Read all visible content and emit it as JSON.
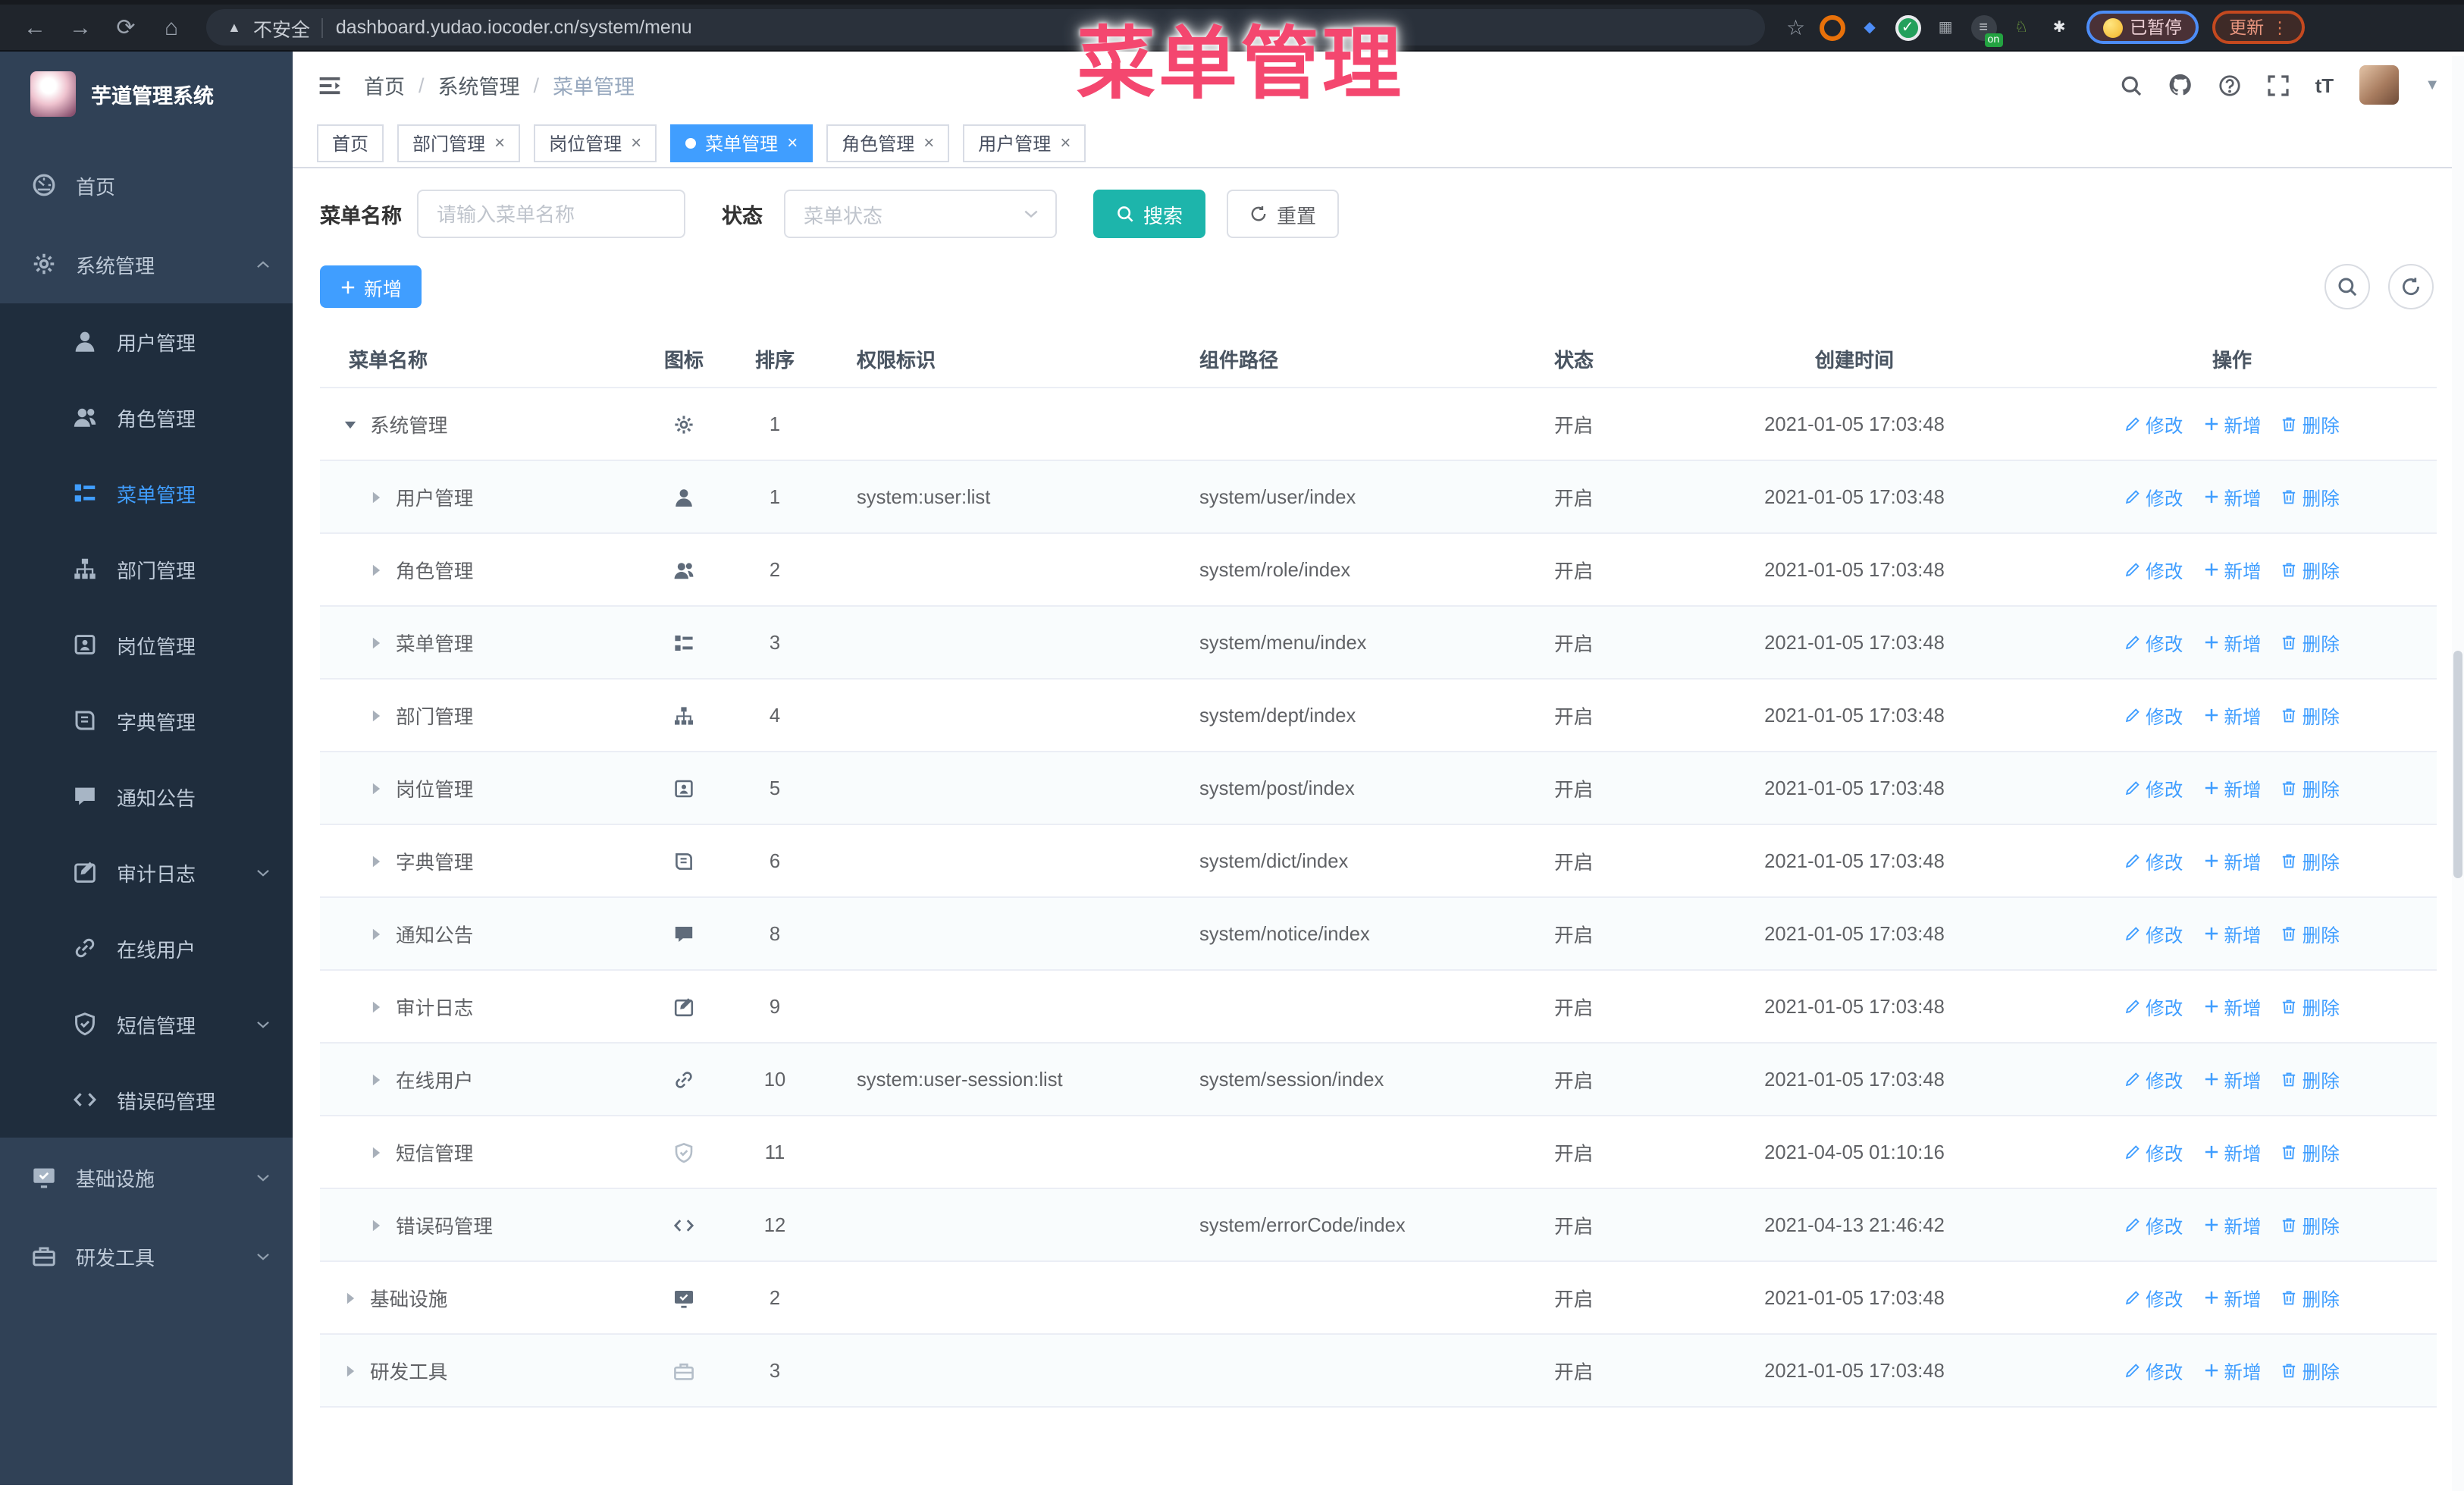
{
  "colors": {
    "accent_blue": "#409eff",
    "search_teal": "#1db5ab",
    "sidebar_bg": "#304156",
    "submenu_bg": "#1f2d3d",
    "overlay_pink": "#f4476f",
    "tab_active_bg": "#409eff"
  },
  "overlay_title": "菜单管理",
  "browser": {
    "back_glyph": "←",
    "forward_glyph": "→",
    "reload_glyph": "⟳",
    "home_glyph": "⌂",
    "warning_glyph": "▲",
    "security_label": "不安全",
    "url": "dashboard.yudao.iocoder.cn/system/menu",
    "star_glyph": "☆",
    "extensions": [
      {
        "name": "extension-icon-orange-ring",
        "glyph": "",
        "color": "#fff",
        "bg": "transparent",
        "border": "3px solid #e8710a"
      },
      {
        "name": "extension-icon-blue-gem",
        "glyph": "◆",
        "color": "#4d8df7",
        "bg": "transparent",
        "border": "none"
      },
      {
        "name": "extension-icon-green-check",
        "glyph": "✓",
        "color": "#fff",
        "bg": "#23a05c",
        "border": "2px solid #e8eaed"
      },
      {
        "name": "extension-icon-gray-tiles",
        "glyph": "▦",
        "color": "#9aa0a6",
        "bg": "transparent",
        "border": "none"
      },
      {
        "name": "extension-icon-dark-on",
        "glyph": "≡",
        "color": "#cdd1d6",
        "bg": "#3a4048",
        "border": "none",
        "badge": "on"
      },
      {
        "name": "extension-icon-green-animal",
        "glyph": "♘",
        "color": "#7cb342",
        "bg": "transparent",
        "border": "none"
      },
      {
        "name": "extension-icon-white-puzzle",
        "glyph": "✱",
        "color": "#e8eaed",
        "bg": "transparent",
        "border": "none"
      }
    ],
    "paused_label": "已暂停",
    "update_label": "更新",
    "update_menu_glyph": "⋮"
  },
  "sidebar": {
    "app_title": "芋道管理系统",
    "items": [
      {
        "label": "首页",
        "icon": "dashboard-icon",
        "level": 0,
        "active": false,
        "chevron": null
      },
      {
        "label": "系统管理",
        "icon": "gear-icon",
        "level": 0,
        "active": false,
        "chevron": "up"
      },
      {
        "label": "用户管理",
        "icon": "user-icon",
        "level": 1,
        "active": false,
        "chevron": null
      },
      {
        "label": "角色管理",
        "icon": "users-icon",
        "level": 1,
        "active": false,
        "chevron": null
      },
      {
        "label": "菜单管理",
        "icon": "menu-list-icon",
        "level": 1,
        "active": true,
        "chevron": null
      },
      {
        "label": "部门管理",
        "icon": "org-tree-icon",
        "level": 1,
        "active": false,
        "chevron": null
      },
      {
        "label": "岗位管理",
        "icon": "id-badge-icon",
        "level": 1,
        "active": false,
        "chevron": null
      },
      {
        "label": "字典管理",
        "icon": "book-icon",
        "level": 1,
        "active": false,
        "chevron": null
      },
      {
        "label": "通知公告",
        "icon": "message-icon",
        "level": 1,
        "active": false,
        "chevron": null
      },
      {
        "label": "审计日志",
        "icon": "edit-log-icon",
        "level": 1,
        "active": false,
        "chevron": "down"
      },
      {
        "label": "在线用户",
        "icon": "link-icon",
        "level": 1,
        "active": false,
        "chevron": null
      },
      {
        "label": "短信管理",
        "icon": "shield-icon",
        "level": 1,
        "active": false,
        "chevron": "down"
      },
      {
        "label": "错误码管理",
        "icon": "code-icon",
        "level": 1,
        "active": false,
        "chevron": null
      },
      {
        "label": "基础设施",
        "icon": "monitor-icon",
        "level": 0,
        "active": false,
        "chevron": "down"
      },
      {
        "label": "研发工具",
        "icon": "toolbox-icon",
        "level": 0,
        "active": false,
        "chevron": "down"
      }
    ]
  },
  "header": {
    "breadcrumb": [
      "首页",
      "系统管理",
      "菜单管理"
    ],
    "separator": "/"
  },
  "tabs": [
    {
      "label": "首页",
      "closable": false,
      "active": false
    },
    {
      "label": "部门管理",
      "closable": true,
      "active": false
    },
    {
      "label": "岗位管理",
      "closable": true,
      "active": false
    },
    {
      "label": "菜单管理",
      "closable": true,
      "active": true
    },
    {
      "label": "角色管理",
      "closable": true,
      "active": false
    },
    {
      "label": "用户管理",
      "closable": true,
      "active": false
    }
  ],
  "filters": {
    "name_label": "菜单名称",
    "name_placeholder": "请输入菜单名称",
    "status_label": "状态",
    "status_placeholder": "菜单状态",
    "search_label": "搜索",
    "reset_label": "重置"
  },
  "toolbar": {
    "add_label": "新增"
  },
  "table": {
    "columns": [
      "菜单名称",
      "图标",
      "排序",
      "权限标识",
      "组件路径",
      "状态",
      "创建时间",
      "操作"
    ],
    "row_actions": [
      {
        "label": "修改",
        "icon": "edit-icon"
      },
      {
        "label": "新增",
        "icon": "plus-icon"
      },
      {
        "label": "删除",
        "icon": "delete-icon"
      }
    ],
    "rows": [
      {
        "name": "系统管理",
        "level": 0,
        "expanded": true,
        "icon": "gear-icon",
        "muted": false,
        "sort": "1",
        "perm": "",
        "path": "",
        "status": "开启",
        "time": "2021-01-05 17:03:48"
      },
      {
        "name": "用户管理",
        "level": 1,
        "expanded": false,
        "icon": "user-icon",
        "muted": false,
        "sort": "1",
        "perm": "system:user:list",
        "path": "system/user/index",
        "status": "开启",
        "time": "2021-01-05 17:03:48"
      },
      {
        "name": "角色管理",
        "level": 1,
        "expanded": false,
        "icon": "users-icon",
        "muted": false,
        "sort": "2",
        "perm": "",
        "path": "system/role/index",
        "status": "开启",
        "time": "2021-01-05 17:03:48"
      },
      {
        "name": "菜单管理",
        "level": 1,
        "expanded": false,
        "icon": "menu-list-icon",
        "muted": false,
        "sort": "3",
        "perm": "",
        "path": "system/menu/index",
        "status": "开启",
        "time": "2021-01-05 17:03:48"
      },
      {
        "name": "部门管理",
        "level": 1,
        "expanded": false,
        "icon": "org-tree-icon",
        "muted": false,
        "sort": "4",
        "perm": "",
        "path": "system/dept/index",
        "status": "开启",
        "time": "2021-01-05 17:03:48"
      },
      {
        "name": "岗位管理",
        "level": 1,
        "expanded": false,
        "icon": "id-badge-icon",
        "muted": false,
        "sort": "5",
        "perm": "",
        "path": "system/post/index",
        "status": "开启",
        "time": "2021-01-05 17:03:48"
      },
      {
        "name": "字典管理",
        "level": 1,
        "expanded": false,
        "icon": "book-icon",
        "muted": false,
        "sort": "6",
        "perm": "",
        "path": "system/dict/index",
        "status": "开启",
        "time": "2021-01-05 17:03:48"
      },
      {
        "name": "通知公告",
        "level": 1,
        "expanded": false,
        "icon": "message-icon",
        "muted": false,
        "sort": "8",
        "perm": "",
        "path": "system/notice/index",
        "status": "开启",
        "time": "2021-01-05 17:03:48"
      },
      {
        "name": "审计日志",
        "level": 1,
        "expanded": false,
        "icon": "edit-log-icon",
        "muted": false,
        "sort": "9",
        "perm": "",
        "path": "",
        "status": "开启",
        "time": "2021-01-05 17:03:48"
      },
      {
        "name": "在线用户",
        "level": 1,
        "expanded": false,
        "icon": "link-icon",
        "muted": false,
        "sort": "10",
        "perm": "system:user-session:list",
        "path": "system/session/index",
        "status": "开启",
        "time": "2021-01-05 17:03:48"
      },
      {
        "name": "短信管理",
        "level": 1,
        "expanded": false,
        "icon": "shield-icon",
        "muted": true,
        "sort": "11",
        "perm": "",
        "path": "",
        "status": "开启",
        "time": "2021-04-05 01:10:16"
      },
      {
        "name": "错误码管理",
        "level": 1,
        "expanded": false,
        "icon": "code-icon",
        "muted": false,
        "sort": "12",
        "perm": "",
        "path": "system/errorCode/index",
        "status": "开启",
        "time": "2021-04-13 21:46:42"
      },
      {
        "name": "基础设施",
        "level": 0,
        "expanded": false,
        "icon": "monitor-icon",
        "muted": false,
        "sort": "2",
        "perm": "",
        "path": "",
        "status": "开启",
        "time": "2021-01-05 17:03:48"
      },
      {
        "name": "研发工具",
        "level": 0,
        "expanded": false,
        "icon": "toolbox-icon",
        "muted": true,
        "sort": "3",
        "perm": "",
        "path": "",
        "status": "开启",
        "time": "2021-01-05 17:03:48"
      }
    ]
  }
}
